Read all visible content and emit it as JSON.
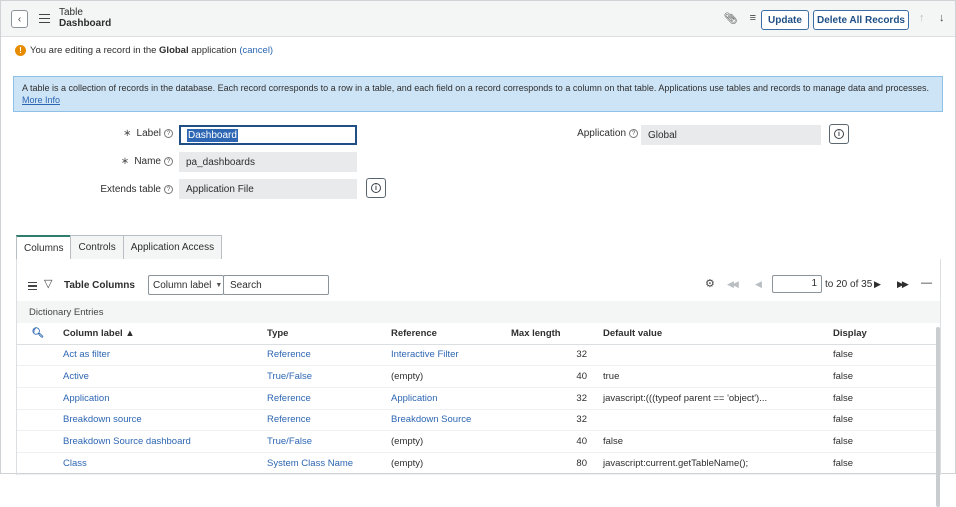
{
  "header": {
    "back_icon": "chevron-left-icon",
    "title_line1": "Table",
    "title_line2": "Dashboard",
    "icons": [
      "paperclip-icon",
      "sliders-icon",
      "more-icon"
    ],
    "update_label": "Update",
    "delete_label": "Delete All Records"
  },
  "notice": {
    "text_before": "You are editing a record in the ",
    "scope": "Global",
    "text_after": " application ",
    "cancel": "(cancel)"
  },
  "info": {
    "text": "A table is a collection of records in the database. Each record corresponds to a row in a table, and each field on a record corresponds to a column on that table. Applications use tables and records to manage data and processes.",
    "more_info": "More Info"
  },
  "form": {
    "label_label": "Label",
    "label_value": "Dashboard",
    "name_label": "Name",
    "name_value": "pa_dashboards",
    "extends_label": "Extends table",
    "extends_value": "Application File",
    "application_label": "Application",
    "application_value": "Global",
    "required_mark": "∗",
    "help_mark": "?"
  },
  "tabs": [
    "Columns",
    "Controls",
    "Application Access"
  ],
  "related_list": {
    "title": "Table Columns",
    "select_value": "Column label",
    "search_placeholder": "Search",
    "page_current": "1",
    "page_text": "to 20 of 35",
    "section_label": "Dictionary Entries",
    "headers": {
      "column_label": "Column label ▲",
      "type": "Type",
      "reference": "Reference",
      "max_length": "Max length",
      "default_value": "Default value",
      "display": "Display"
    },
    "rows": [
      {
        "column_label": "Act as filter",
        "type": "Reference",
        "reference": "Interactive Filter",
        "max_length": "32",
        "default_value": "",
        "display": "false"
      },
      {
        "column_label": "Active",
        "type": "True/False",
        "reference": "(empty)",
        "max_length": "40",
        "default_value": "true",
        "display": "false"
      },
      {
        "column_label": "Application",
        "type": "Reference",
        "reference": "Application",
        "max_length": "32",
        "default_value": "javascript:(((typeof parent == 'object')...",
        "display": "false"
      },
      {
        "column_label": "Breakdown source",
        "type": "Reference",
        "reference": "Breakdown Source",
        "max_length": "32",
        "default_value": "",
        "display": "false"
      },
      {
        "column_label": "Breakdown Source dashboard",
        "type": "True/False",
        "reference": "(empty)",
        "max_length": "40",
        "default_value": "false",
        "display": "false"
      },
      {
        "column_label": "Class",
        "type": "System Class Name",
        "reference": "(empty)",
        "max_length": "80",
        "default_value": "javascript:current.getTableName();",
        "display": "false"
      }
    ]
  }
}
